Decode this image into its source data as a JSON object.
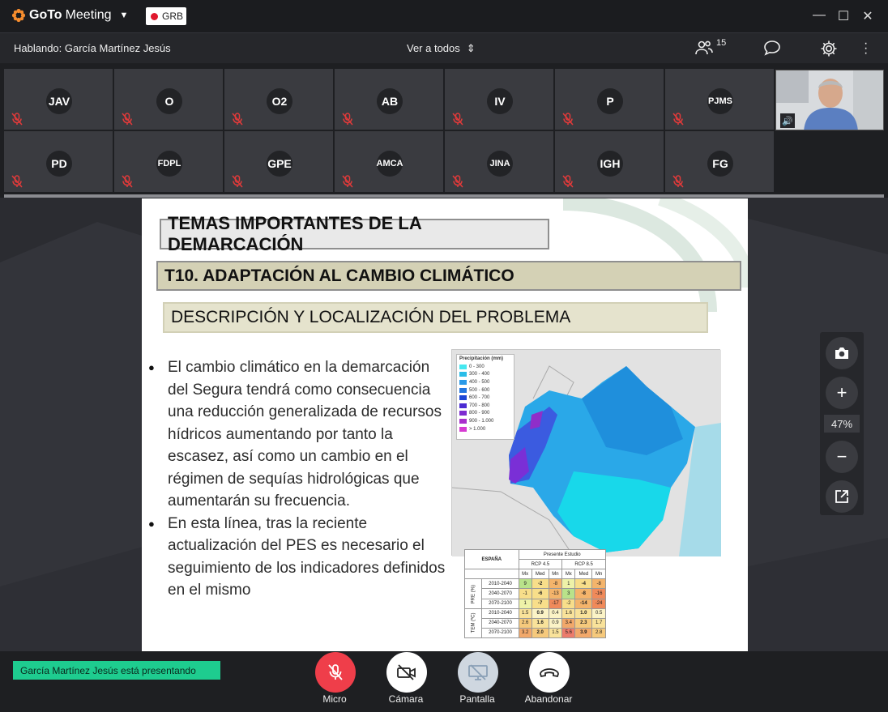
{
  "app": {
    "name_go": "GoTo",
    "name_meeting": "Meeting",
    "badge": "GRB"
  },
  "topbar": {
    "speaking": "Hablando: García Martínez Jesús",
    "view_mode": "Ver a todos",
    "participants_count": "15"
  },
  "participants": [
    {
      "initials": "JAV"
    },
    {
      "initials": "O"
    },
    {
      "initials": "O2"
    },
    {
      "initials": "AB"
    },
    {
      "initials": "IV"
    },
    {
      "initials": "P"
    },
    {
      "initials": "PJMS"
    },
    {
      "initials": "PD"
    },
    {
      "initials": "FDPL"
    },
    {
      "initials": "GPE"
    },
    {
      "initials": "AMCA"
    },
    {
      "initials": "JINA"
    },
    {
      "initials": "IGH"
    },
    {
      "initials": "FG"
    }
  ],
  "slide": {
    "title1": "TEMAS IMPORTANTES DE LA DEMARCACIÓN",
    "title2": "T10. ADAPTACIÓN AL CAMBIO CLIMÁTICO",
    "title3": "DESCRIPCIÓN Y LOCALIZACIÓN DEL PROBLEMA",
    "bullet1": "El cambio climático en la demarcación del Segura tendrá como consecuencia una reducción generalizada de recursos hídricos aumentando por tanto la escasez, así como un cambio en el régimen de sequías hidrológicas que aumentarán su frecuencia.",
    "bullet2": "En esta línea, tras la reciente actualización del PES es necesario el seguimiento de los indicadores definidos en el mismo",
    "map_legend_title": "Precipitación (mm)",
    "map_legend": [
      "0 - 300",
      "300 - 400",
      "400 - 500",
      "500 - 600",
      "600 - 700",
      "700 - 800",
      "800 - 900",
      "900 - 1.000",
      "> 1.000"
    ],
    "table": {
      "country": "ESPAÑA",
      "study": "Presente Estudio",
      "rcp45": "RCP 4.5",
      "rcp85": "RCP 8.5",
      "sub": [
        "Mx",
        "Med",
        "Mn",
        "Mx",
        "Med",
        "Mn"
      ],
      "pre_label": "PRE (%)",
      "tem_label": "TEM (ºC)",
      "pre_rows": [
        {
          "period": "2010-2040",
          "v": [
            "9",
            "-2",
            "-8",
            "1",
            "-4",
            "-8"
          ]
        },
        {
          "period": "2040-2070",
          "v": [
            "-1",
            "-6",
            "-13",
            "3",
            "-8",
            "-16"
          ]
        },
        {
          "period": "2070-2100",
          "v": [
            "1",
            "-7",
            "-17",
            "-2",
            "-14",
            "-24"
          ]
        }
      ],
      "tem_rows": [
        {
          "period": "2010-2040",
          "v": [
            "1.5",
            "0.9",
            "0.4",
            "1.6",
            "1.0",
            "0.5"
          ]
        },
        {
          "period": "2040-2070",
          "v": [
            "2.6",
            "1.6",
            "0.9",
            "3.4",
            "2.3",
            "1.7"
          ]
        },
        {
          "period": "2070-2100",
          "v": [
            "3.2",
            "2.0",
            "1.5",
            "5.6",
            "3.9",
            "2.8"
          ]
        }
      ]
    }
  },
  "zoom": {
    "percent": "47%"
  },
  "bottom": {
    "presenting": "García Martínez Jesús está presentando",
    "mic": "Micro",
    "camera": "Cámara",
    "screen": "Pantalla",
    "leave": "Abandonar"
  }
}
